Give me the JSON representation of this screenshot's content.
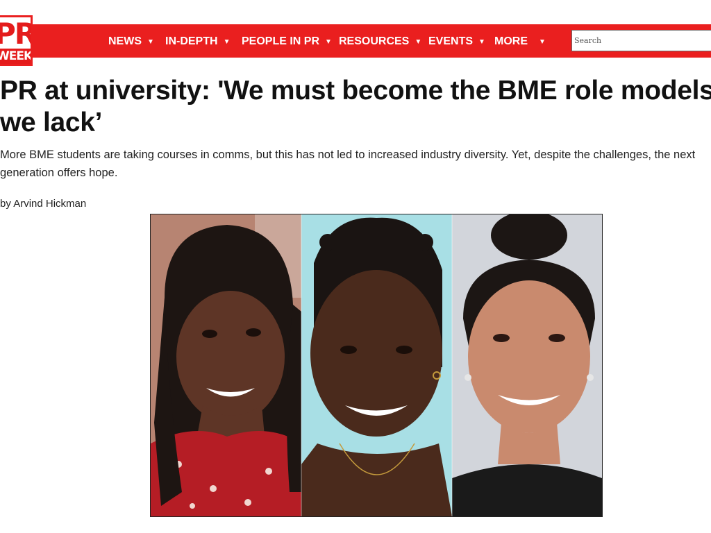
{
  "brand": {
    "logo_top": "PR",
    "logo_bottom": "WEEK",
    "red": "#ea1f1f"
  },
  "nav": {
    "items": [
      {
        "label": "NEWS",
        "caret": "▼"
      },
      {
        "label": "IN-DEPTH",
        "caret": "▼"
      },
      {
        "label": "PEOPLE IN PR",
        "caret": "▼"
      },
      {
        "label": "RESOURCES",
        "caret": "▼"
      },
      {
        "label": "EVENTS",
        "caret": "▼"
      },
      {
        "label": "MORE",
        "caret": "▼"
      }
    ],
    "search_placeholder": "Search"
  },
  "article": {
    "headline": "PR at university: 'We must become the BME role models we lack’",
    "standfirst": "More BME students are taking courses in comms, but this has not led to increased industry diversity. Yet, despite the challenges, the next generation offers hope.",
    "byline_prefix": "by ",
    "author": "Arvind Hickman"
  },
  "hero": {
    "panel_count": 3,
    "subject": "three-student-portraits"
  }
}
